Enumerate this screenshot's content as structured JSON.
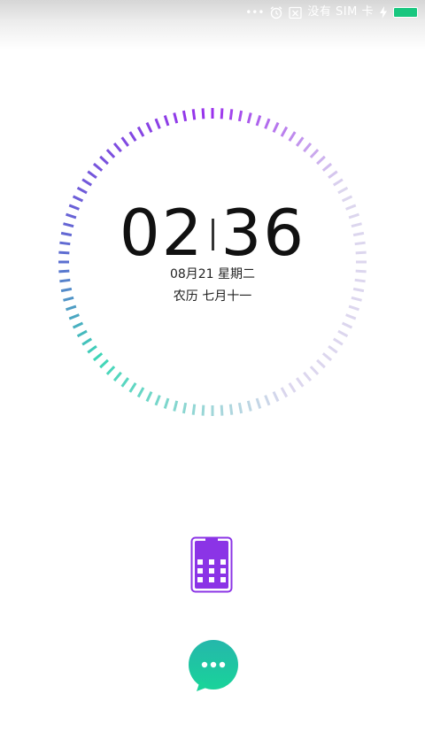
{
  "status_bar": {
    "dots": "•••",
    "no_sim_text": "没有 SIM 卡",
    "icons": [
      "more-icon",
      "alarm-icon",
      "no-sim-icon",
      "charging-icon",
      "battery-icon"
    ],
    "battery_color": "#18c77f",
    "battery_level": 1.0
  },
  "clock": {
    "hours": "02",
    "minutes": "36",
    "date": "08月21 星期二",
    "lunar": "农历 七月十一",
    "dial_colors": {
      "purple": "#9a31ec",
      "blue": "#5b6fd0",
      "teal": "#3dd6b6",
      "light": "#dcd6ee"
    }
  },
  "shortcuts": {
    "calculator_icon": "calculator-icon",
    "calculator_color": "#8b34e6",
    "messages_icon": "messages-icon",
    "messages_gradient": [
      "#25b7ab",
      "#19d39a"
    ]
  }
}
